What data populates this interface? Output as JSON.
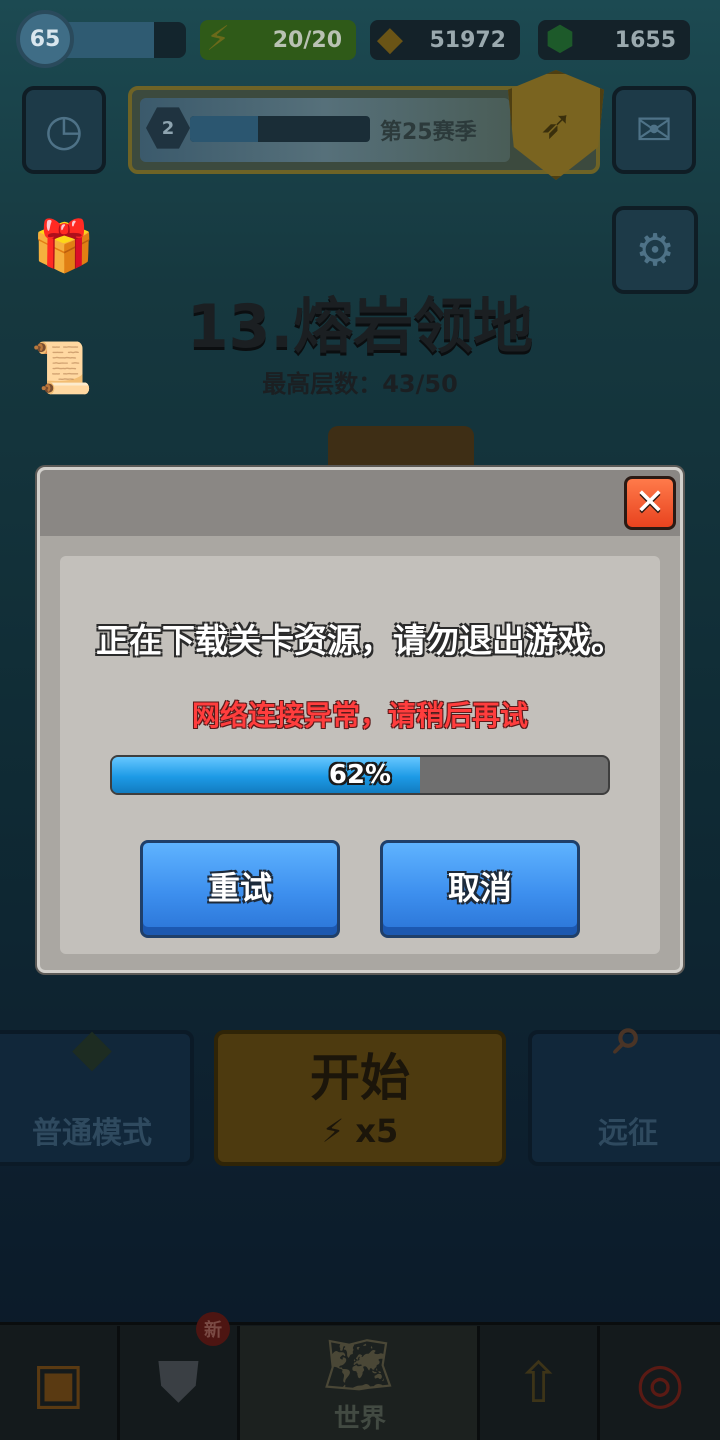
{
  "player": {
    "level": "65"
  },
  "resources": {
    "energy": "20/20",
    "gold": "51972",
    "gems": "1655"
  },
  "season": {
    "rank": "2",
    "label": "第25赛季"
  },
  "stage": {
    "title": "13.熔岩领地",
    "subtitle": "最高层数：43/50"
  },
  "modes": {
    "normal": "普通模式",
    "start": "开始",
    "start_cost": "x5",
    "expedition": "远征"
  },
  "tabbar": {
    "new_badge": "新",
    "world": "世界"
  },
  "dialog": {
    "message": "正在下载关卡资源，请勿退出游戏。",
    "error": "网络连接异常，请稍后再试",
    "progress_percent": 62,
    "progress_text": "62%",
    "retry_label": "重试",
    "cancel_label": "取消",
    "close_glyph": "✕"
  },
  "icons": {
    "energy": "lightning-icon",
    "gold": "gold-icon",
    "gems": "gem-icon",
    "history": "history-icon",
    "mail": "mail-icon",
    "settings": "gear-icon"
  },
  "colors": {
    "progress_fill": "#1d9ae6",
    "error_text": "#ff3d3d",
    "button_blue": "#3d8fee",
    "close_red": "#e8431f"
  }
}
